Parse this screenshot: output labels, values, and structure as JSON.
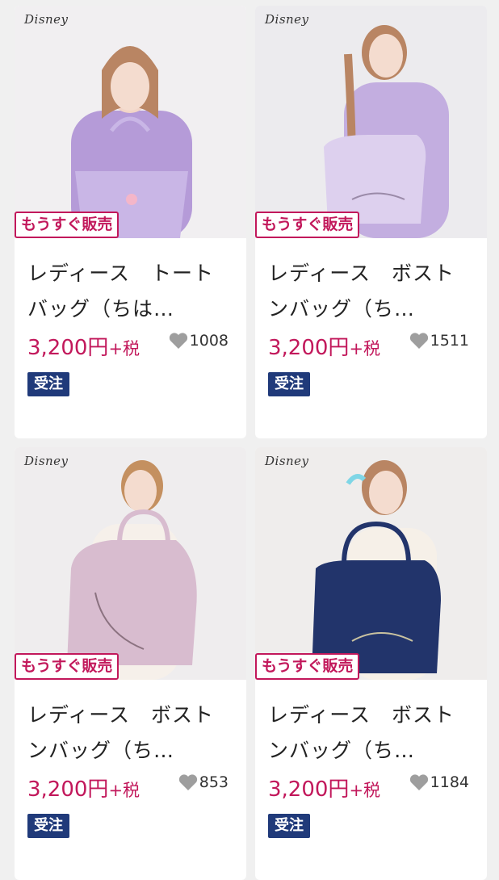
{
  "products": [
    {
      "brand": "Disney",
      "badge": "もうすぐ販売",
      "title": "レディース　トートバッグ（ちは…",
      "price": "3,200円",
      "tax": "+税",
      "likes": "1008",
      "order_label": "受注",
      "colors": {
        "bg": "#f1eff1",
        "bag": "#c9b6e6",
        "dress": "#b59bd8"
      }
    },
    {
      "brand": "Disney",
      "badge": "もうすぐ販売",
      "title": "レディース　ボストンバッグ（ち…",
      "price": "3,200円",
      "tax": "+税",
      "likes": "1511",
      "order_label": "受注",
      "colors": {
        "bg": "#ecebee",
        "bag": "#ddd0ee",
        "dress": "#c3aee0"
      }
    },
    {
      "brand": "Disney",
      "badge": "もうすぐ販売",
      "title": "レディース　ボストンバッグ（ち…",
      "price": "3,200円",
      "tax": "+税",
      "likes": "853",
      "order_label": "受注",
      "colors": {
        "bg": "#efedee",
        "bag": "#d8bccf",
        "dress": "#f6f0ea"
      }
    },
    {
      "brand": "Disney",
      "badge": "もうすぐ販売",
      "title": "レディース　ボストンバッグ（ち…",
      "price": "3,200円",
      "tax": "+税",
      "likes": "1184",
      "order_label": "受注",
      "colors": {
        "bg": "#efedec",
        "bag": "#22346b",
        "dress": "#f6f0e8"
      }
    }
  ]
}
